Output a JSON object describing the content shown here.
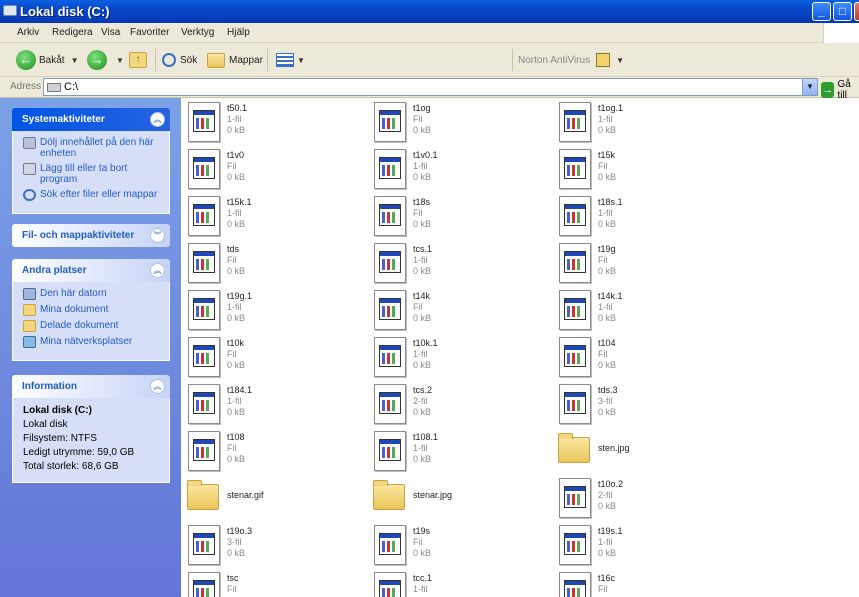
{
  "window": {
    "title": "Lokal disk (C:)",
    "buttons": [
      "_",
      "□",
      "X"
    ]
  },
  "menu": [
    "Arkiv",
    "Redigera",
    "Visa",
    "Favoriter",
    "Verktyg",
    "Hjälp"
  ],
  "toolbar": {
    "back": "Bakåt",
    "search": "Sök",
    "folders": "Mappar",
    "norton": "Norton AntiVirus"
  },
  "address": {
    "label": "Adress",
    "value": "C:\\",
    "go": "Gå till"
  },
  "left": {
    "system": {
      "title": "Systemaktiviteter",
      "items": [
        "Dölj innehållet på den här enheten",
        "Lägg till eller ta bort program",
        "Sök efter filer eller mappar"
      ]
    },
    "file": {
      "title": "Fil- och mappaktiviteter"
    },
    "other": {
      "title": "Andra platser",
      "items": [
        "Den här datorn",
        "Mina dokument",
        "Delade dokument",
        "Mina nätverksplatser"
      ]
    },
    "info": {
      "title": "Information",
      "name": "Lokal disk (C:)",
      "type": "Lokal disk",
      "fs": "Filsystem: NTFS",
      "free": "Ledigt utrymme: 59,0 GB",
      "total": "Total storlek: 68,6 GB"
    }
  },
  "files": [
    {
      "name": "t50.1",
      "type": "1-fil",
      "size": "0 kB",
      "kind": "doc"
    },
    {
      "name": "t1og",
      "type": "Fil",
      "size": "0 kB",
      "kind": "doc"
    },
    {
      "name": "t1og.1",
      "type": "1-fil",
      "size": "0 kB",
      "kind": "doc"
    },
    {
      "name": "t1v0",
      "type": "Fil",
      "size": "0 kB",
      "kind": "doc"
    },
    {
      "name": "t1v0.1",
      "type": "1-fil",
      "size": "0 kB",
      "kind": "doc"
    },
    {
      "name": "t15k",
      "type": "Fil",
      "size": "0 kB",
      "kind": "doc"
    },
    {
      "name": "t15k.1",
      "type": "1-fil",
      "size": "0 kB",
      "kind": "doc"
    },
    {
      "name": "t18s",
      "type": "Fil",
      "size": "0 kB",
      "kind": "doc"
    },
    {
      "name": "t18s.1",
      "type": "1-fil",
      "size": "0 kB",
      "kind": "doc"
    },
    {
      "name": "tds",
      "type": "Fil",
      "size": "0 kB",
      "kind": "doc"
    },
    {
      "name": "tcs.1",
      "type": "1-fil",
      "size": "0 kB",
      "kind": "doc"
    },
    {
      "name": "t19g",
      "type": "Fil",
      "size": "0 kB",
      "kind": "doc"
    },
    {
      "name": "t19g.1",
      "type": "1-fil",
      "size": "0 kB",
      "kind": "doc"
    },
    {
      "name": "t14k",
      "type": "Fil",
      "size": "0 kB",
      "kind": "doc"
    },
    {
      "name": "t14k.1",
      "type": "1-fil",
      "size": "0 kB",
      "kind": "doc"
    },
    {
      "name": "t10k",
      "type": "Fil",
      "size": "0 kB",
      "kind": "doc"
    },
    {
      "name": "t10k.1",
      "type": "1-fil",
      "size": "0 kB",
      "kind": "doc"
    },
    {
      "name": "t104",
      "type": "Fil",
      "size": "0 kB",
      "kind": "doc"
    },
    {
      "name": "t184.1",
      "type": "1-fil",
      "size": "0 kB",
      "kind": "doc"
    },
    {
      "name": "tcs.2",
      "type": "2-fil",
      "size": "0 kB",
      "kind": "doc"
    },
    {
      "name": "tds.3",
      "type": "3-fil",
      "size": "0 kB",
      "kind": "doc"
    },
    {
      "name": "t108",
      "type": "Fil",
      "size": "0 kB",
      "kind": "doc"
    },
    {
      "name": "t108.1",
      "type": "1-fil",
      "size": "0 kB",
      "kind": "doc"
    },
    {
      "name": "sten.jpg",
      "type": "",
      "size": "",
      "kind": "folder"
    },
    {
      "name": "stenar.gif",
      "type": "",
      "size": "",
      "kind": "folder"
    },
    {
      "name": "stenar.jpg",
      "type": "",
      "size": "",
      "kind": "folder"
    },
    {
      "name": "t10o.2",
      "type": "2-fil",
      "size": "0 kB",
      "kind": "doc"
    },
    {
      "name": "t19o.3",
      "type": "3-fil",
      "size": "0 kB",
      "kind": "doc"
    },
    {
      "name": "t19s",
      "type": "Fil",
      "size": "0 kB",
      "kind": "doc"
    },
    {
      "name": "t19s.1",
      "type": "1-fil",
      "size": "0 kB",
      "kind": "doc"
    },
    {
      "name": "tsc",
      "type": "Fil",
      "size": "",
      "kind": "doc"
    },
    {
      "name": "tcc.1",
      "type": "1-fil",
      "size": "",
      "kind": "doc"
    },
    {
      "name": "t16c",
      "type": "Fil",
      "size": "",
      "kind": "doc"
    }
  ]
}
